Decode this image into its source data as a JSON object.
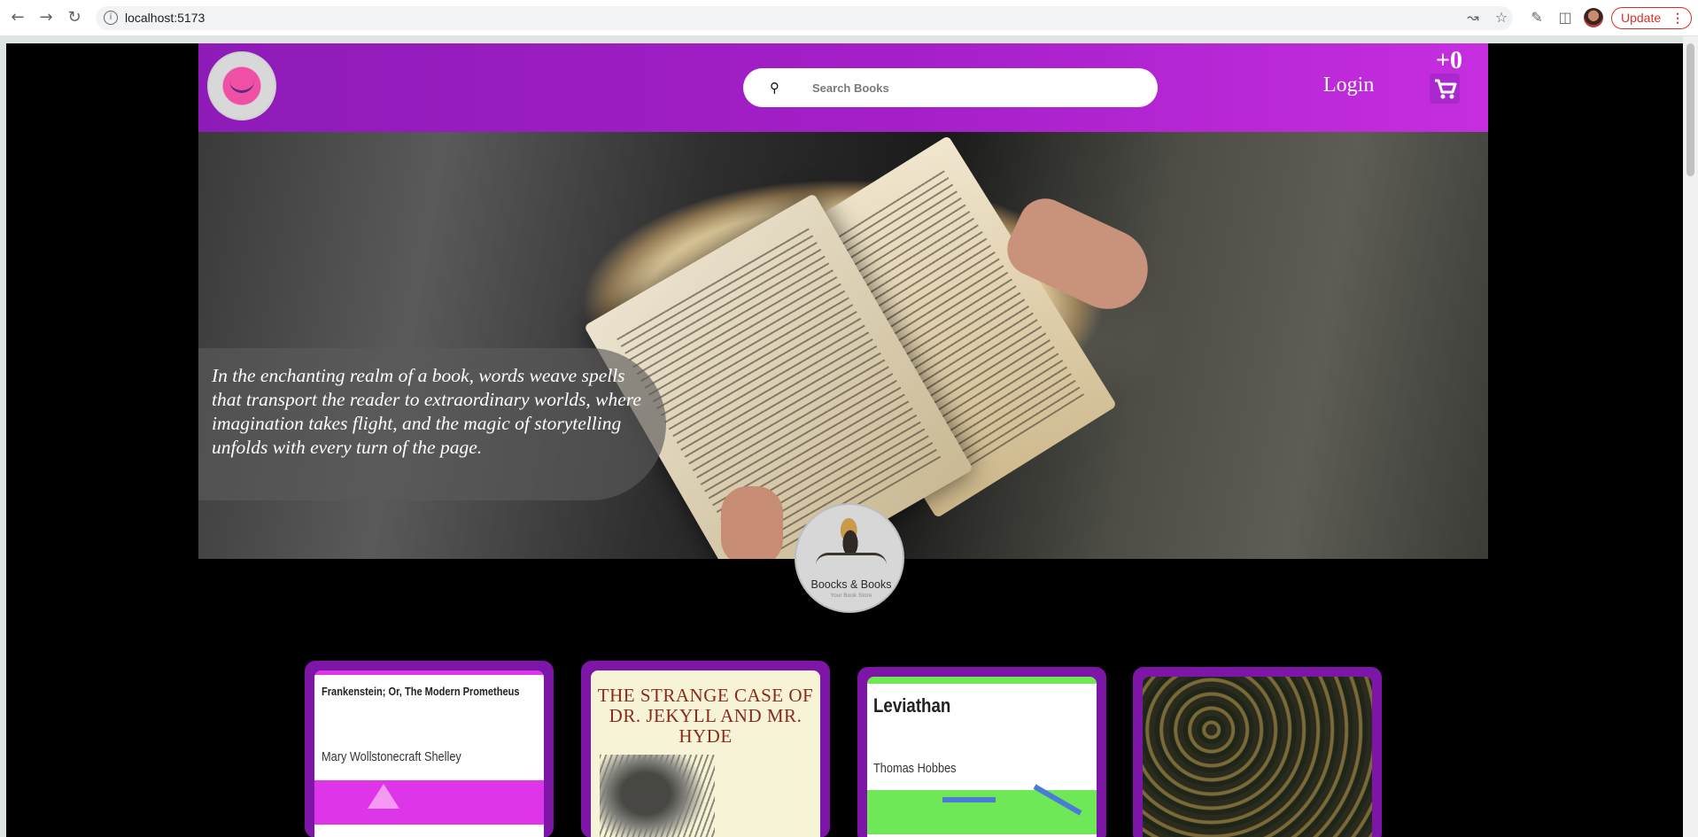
{
  "browser": {
    "url": "localhost:5173",
    "update_label": "Update"
  },
  "header": {
    "search_placeholder": "Search Books",
    "login_label": "Login",
    "cart_count": "+0"
  },
  "hero": {
    "quote": "In the enchanting realm of a book, words weave spells that transport the reader to extraordinary worlds, where imagination takes flight, and the magic of storytelling unfolds with every turn of the page."
  },
  "brand": {
    "name": "Boocks & Books",
    "tagline": "Your Book Store"
  },
  "books": [
    {
      "title": "Frankenstein; Or, The Modern Prometheus",
      "author": "Mary Wollstonecraft Shelley"
    },
    {
      "title": "THE STRANGE CASE OF DR. JEKYLL AND MR. HYDE"
    },
    {
      "title": "Leviathan",
      "author": "Thomas Hobbes"
    },
    {
      "title": ""
    }
  ],
  "colors": {
    "header_gradient_start": "#8e1bb7",
    "header_gradient_end": "#c62ee0",
    "card_frame": "#7d16a7",
    "page_background": "#000000"
  }
}
